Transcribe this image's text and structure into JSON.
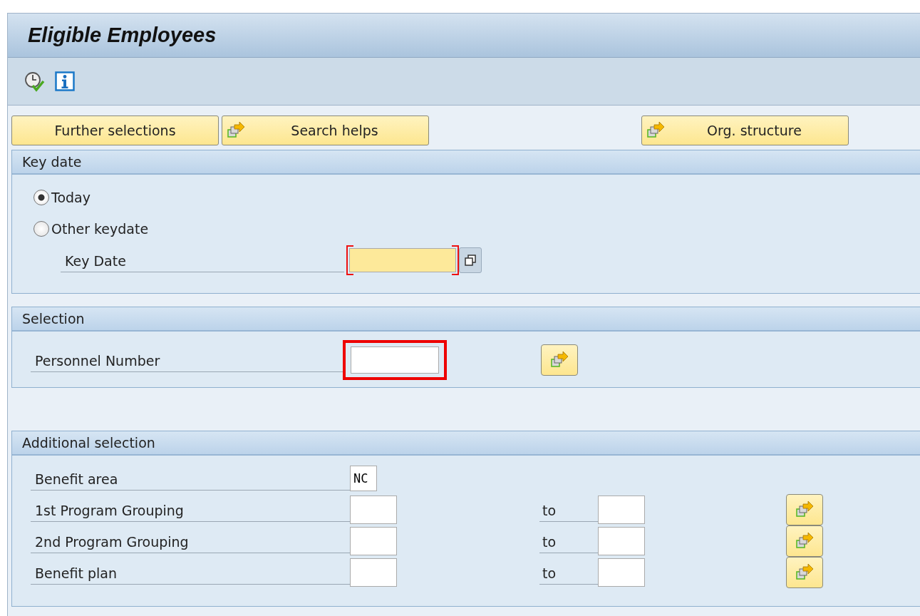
{
  "window": {
    "title": "Eligible Employees"
  },
  "buttons_left": [
    {
      "label": "Further selections",
      "icon": false
    },
    {
      "label": "Search helps",
      "icon": true
    }
  ],
  "buttons_right": [
    {
      "label": "Org. structure",
      "icon": true
    }
  ],
  "key_date": {
    "title": "Key date",
    "options": [
      {
        "label": "Today",
        "selected": true
      },
      {
        "label": "Other keydate",
        "selected": false
      }
    ],
    "field": {
      "label": "Key Date",
      "required": true
    }
  },
  "selection": {
    "title": "Selection",
    "fields": [
      {
        "label": "Personnel Number",
        "highlighted": true
      }
    ]
  },
  "additional_selection": {
    "title": "Additional selection",
    "rows": [
      {
        "kind": "single",
        "label": "Benefit area",
        "value": "NC"
      },
      {
        "kind": "range",
        "label": "1st Program Grouping",
        "to_label": "to"
      },
      {
        "kind": "range",
        "label": "2nd Program Grouping",
        "to_label": "to"
      },
      {
        "kind": "range",
        "label": "Benefit plan",
        "to_label": "to"
      }
    ]
  }
}
